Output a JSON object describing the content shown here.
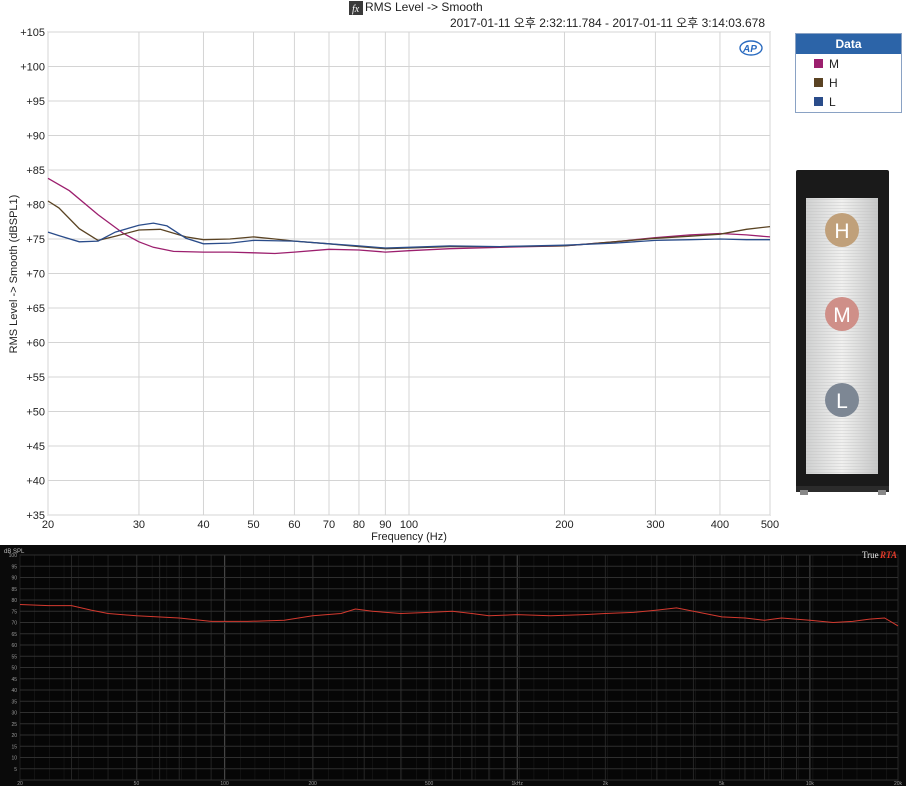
{
  "chart_data": [
    {
      "type": "line",
      "title": "RMS Level -> Smooth",
      "subtitle": "2017-01-11 오후 2:32:11.784 - 2017-01-11 오후 3:14:03.678",
      "xlabel": "Frequency (Hz)",
      "ylabel": "RMS Level -> Smooth (dBSPL1)",
      "x_scale": "log",
      "xlim": [
        20,
        500
      ],
      "ylim": [
        35,
        105
      ],
      "x_ticks": [
        20,
        30,
        40,
        50,
        60,
        70,
        80,
        90,
        100,
        200,
        300,
        400,
        500
      ],
      "y_ticks": [
        "+35",
        "+40",
        "+45",
        "+50",
        "+55",
        "+60",
        "+65",
        "+70",
        "+75",
        "+80",
        "+85",
        "+90",
        "+95",
        "+100",
        "+105"
      ],
      "grid": true,
      "legend_title": "Data",
      "legend_position": "right",
      "series": [
        {
          "name": "M",
          "color": "#9c1f6e",
          "points": [
            [
              20,
              83.8
            ],
            [
              22,
              82
            ],
            [
              25,
              78.5
            ],
            [
              28,
              75.8
            ],
            [
              30,
              74.6
            ],
            [
              32,
              73.8
            ],
            [
              35,
              73.2
            ],
            [
              40,
              73.1
            ],
            [
              45,
              73.1
            ],
            [
              50,
              73.0
            ],
            [
              55,
              72.9
            ],
            [
              60,
              73.1
            ],
            [
              70,
              73.5
            ],
            [
              80,
              73.4
            ],
            [
              90,
              73.1
            ],
            [
              100,
              73.3
            ],
            [
              120,
              73.6
            ],
            [
              150,
              73.8
            ],
            [
              200,
              74.0
            ],
            [
              250,
              74.6
            ],
            [
              300,
              75.2
            ],
            [
              350,
              75.6
            ],
            [
              400,
              75.8
            ],
            [
              450,
              75.6
            ],
            [
              500,
              75.3
            ]
          ]
        },
        {
          "name": "H",
          "color": "#5a4323",
          "points": [
            [
              20,
              80.5
            ],
            [
              21,
              79.5
            ],
            [
              23,
              76.5
            ],
            [
              25,
              74.8
            ],
            [
              27,
              75.4
            ],
            [
              30,
              76.3
            ],
            [
              33,
              76.4
            ],
            [
              37,
              75.3
            ],
            [
              40,
              74.9
            ],
            [
              45,
              75.0
            ],
            [
              50,
              75.3
            ],
            [
              55,
              75.0
            ],
            [
              60,
              74.7
            ],
            [
              70,
              74.3
            ],
            [
              80,
              73.9
            ],
            [
              90,
              73.6
            ],
            [
              100,
              73.7
            ],
            [
              120,
              73.9
            ],
            [
              150,
              73.9
            ],
            [
              200,
              74.0
            ],
            [
              250,
              74.6
            ],
            [
              300,
              75.1
            ],
            [
              350,
              75.4
            ],
            [
              400,
              75.7
            ],
            [
              450,
              76.4
            ],
            [
              500,
              76.8
            ]
          ]
        },
        {
          "name": "L",
          "color": "#2a4c8a",
          "points": [
            [
              20,
              76.0
            ],
            [
              21,
              75.5
            ],
            [
              23,
              74.6
            ],
            [
              25,
              74.7
            ],
            [
              27,
              76.0
            ],
            [
              30,
              77.0
            ],
            [
              32,
              77.3
            ],
            [
              34,
              76.9
            ],
            [
              37,
              75.1
            ],
            [
              40,
              74.3
            ],
            [
              45,
              74.4
            ],
            [
              50,
              74.8
            ],
            [
              60,
              74.7
            ],
            [
              70,
              74.3
            ],
            [
              80,
              74.0
            ],
            [
              90,
              73.7
            ],
            [
              100,
              73.8
            ],
            [
              120,
              74.0
            ],
            [
              150,
              73.9
            ],
            [
              200,
              74.1
            ],
            [
              250,
              74.4
            ],
            [
              300,
              74.8
            ],
            [
              350,
              74.9
            ],
            [
              400,
              75.0
            ],
            [
              450,
              74.9
            ],
            [
              500,
              74.9
            ]
          ]
        }
      ]
    },
    {
      "type": "line",
      "app": "TrueRTA",
      "app_label_prefix": "True",
      "app_label_suffix": "RTA",
      "ylabel": "dB SPL",
      "x_scale": "log",
      "xlim": [
        20,
        20000
      ],
      "ylim": [
        0,
        100
      ],
      "x_ticks": [
        "20",
        "",
        "50",
        "100",
        "200",
        "",
        "500",
        "1kHz",
        "2k",
        "",
        "5k",
        "10k",
        "",
        "20k"
      ],
      "y_ticks": [
        "100",
        "95",
        "90",
        "85",
        "80",
        "75",
        "70",
        "65",
        "60",
        "55",
        "50",
        "45",
        "40",
        "35",
        "30",
        "25",
        "20",
        "15",
        "10",
        "5"
      ],
      "grid": true,
      "series": [
        {
          "name": "",
          "color": "#d43a2f",
          "points": [
            [
              20,
              78
            ],
            [
              25,
              77.5
            ],
            [
              30,
              77.5
            ],
            [
              35,
              75.5
            ],
            [
              40,
              74
            ],
            [
              50,
              73
            ],
            [
              70,
              72
            ],
            [
              90,
              70.5
            ],
            [
              120,
              70.5
            ],
            [
              160,
              71
            ],
            [
              200,
              73
            ],
            [
              250,
              74
            ],
            [
              280,
              76
            ],
            [
              320,
              75
            ],
            [
              400,
              74
            ],
            [
              500,
              74.5
            ],
            [
              600,
              75
            ],
            [
              700,
              74
            ],
            [
              800,
              73
            ],
            [
              1000,
              73.5
            ],
            [
              1300,
              73
            ],
            [
              1700,
              73.5
            ],
            [
              2000,
              74
            ],
            [
              2500,
              74.5
            ],
            [
              3000,
              75.5
            ],
            [
              3500,
              76.5
            ],
            [
              4000,
              75
            ],
            [
              5000,
              72.5
            ],
            [
              6000,
              72
            ],
            [
              7000,
              71
            ],
            [
              8000,
              72
            ],
            [
              10000,
              71
            ],
            [
              12000,
              70
            ],
            [
              14000,
              70.5
            ],
            [
              16000,
              71.5
            ],
            [
              18000,
              72
            ],
            [
              20000,
              68.5
            ]
          ]
        }
      ]
    }
  ],
  "badge_text": "AP",
  "fx_icon_text": "fx",
  "speaker_labels": [
    "H",
    "M",
    "L"
  ]
}
